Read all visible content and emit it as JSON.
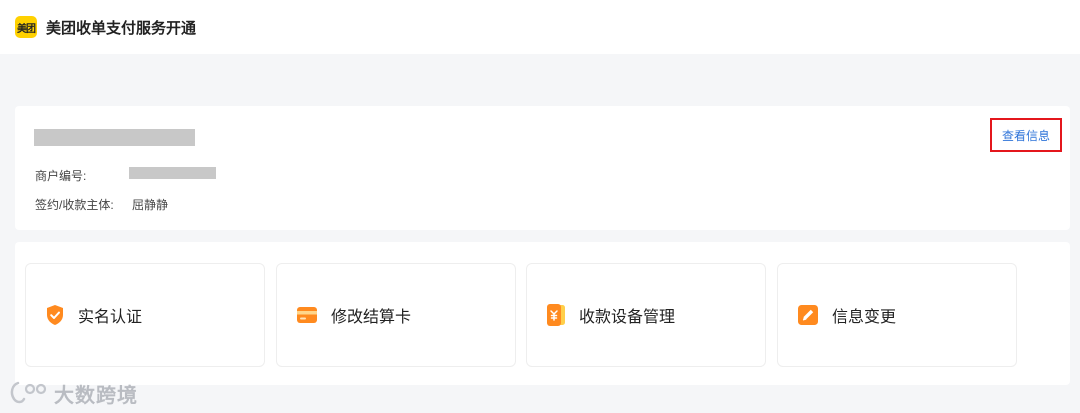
{
  "header": {
    "logo_text": "美团",
    "title": "美团收单支付服务开通"
  },
  "merchant": {
    "view_label": "查看信息",
    "fields": [
      {
        "label": "商户编号:",
        "value": ""
      },
      {
        "label": "签约/收款主体:",
        "value": "屈静静"
      }
    ]
  },
  "services": [
    {
      "label": "实名认证",
      "icon": "shield-check-icon",
      "color": "#ff8a1f"
    },
    {
      "label": "修改结算卡",
      "icon": "card-icon",
      "color": "#ff8a1f"
    },
    {
      "label": "收款设备管理",
      "icon": "payment-device-icon",
      "color": "#ff8a1f"
    },
    {
      "label": "信息变更",
      "icon": "edit-icon",
      "color": "#ff8a1f"
    }
  ],
  "watermark": {
    "text": "大数跨境"
  },
  "colors": {
    "brand": "#ffd100",
    "link": "#2f74d9",
    "highlight": "#e4161c",
    "page_bg": "#f5f6f8"
  }
}
